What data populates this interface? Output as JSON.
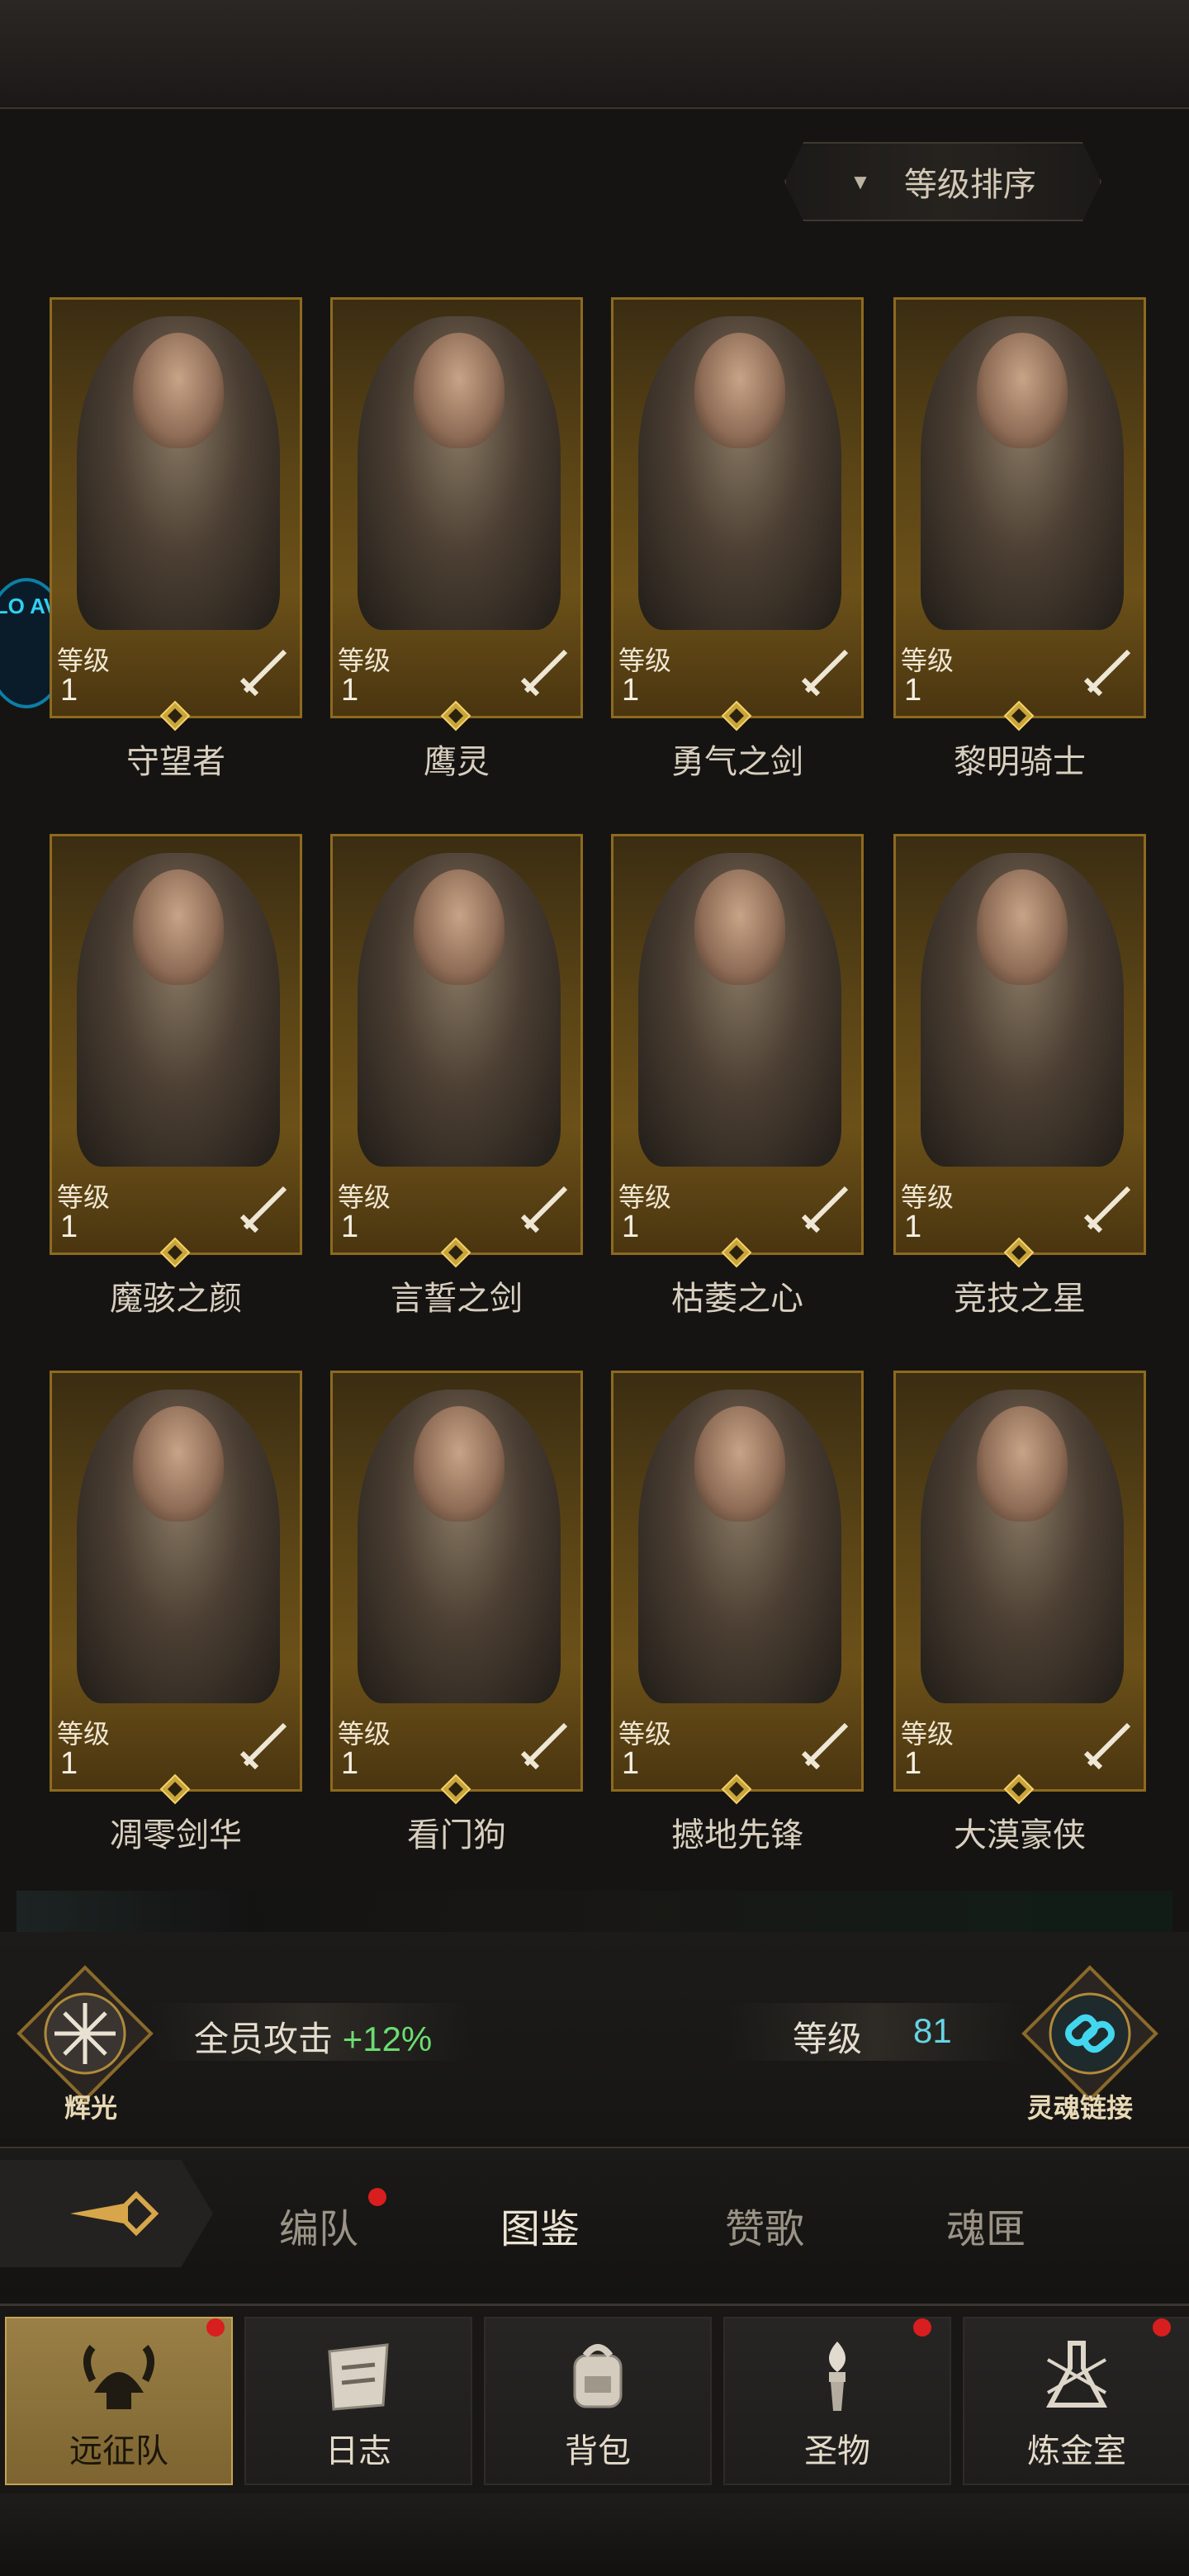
{
  "sort": {
    "label": "等级排序"
  },
  "heroes": [
    {
      "name": "守望者",
      "level_label": "等级",
      "level": "1"
    },
    {
      "name": "鹰灵",
      "level_label": "等级",
      "level": "1"
    },
    {
      "name": "勇气之剑",
      "level_label": "等级",
      "level": "1"
    },
    {
      "name": "黎明骑士",
      "level_label": "等级",
      "level": "1"
    },
    {
      "name": "魔骇之颜",
      "level_label": "等级",
      "level": "1"
    },
    {
      "name": "言誓之剑",
      "level_label": "等级",
      "level": "1"
    },
    {
      "name": "枯萎之心",
      "level_label": "等级",
      "level": "1"
    },
    {
      "name": "竞技之星",
      "level_label": "等级",
      "level": "1"
    },
    {
      "name": "凋零剑华",
      "level_label": "等级",
      "level": "1"
    },
    {
      "name": "看门狗",
      "level_label": "等级",
      "level": "1"
    },
    {
      "name": "撼地先锋",
      "level_label": "等级",
      "level": "1"
    },
    {
      "name": "大漠豪侠",
      "level_label": "等级",
      "level": "1"
    }
  ],
  "bonus": {
    "emblem_label": "辉光",
    "text": "全员攻击",
    "value": "+12%",
    "level_label": "等级",
    "level_value": "81",
    "link_label": "灵魂链接"
  },
  "tabs": [
    {
      "label": "编队",
      "has_dot": true
    },
    {
      "label": "图鉴",
      "active": true
    },
    {
      "label": "赞歌"
    },
    {
      "label": "魂匣"
    }
  ],
  "nav": [
    {
      "label": "远征队",
      "active": true,
      "has_dot": true
    },
    {
      "label": "日志"
    },
    {
      "label": "背包"
    },
    {
      "label": "圣物",
      "has_dot": true
    },
    {
      "label": "炼金室",
      "has_dot": true
    }
  ],
  "side_badge": {
    "label": "LO AV"
  },
  "colors": {
    "accent_gold": "#8d6a1f",
    "bonus_green": "#6cdc72",
    "level_cyan": "#67d4e4",
    "dot_red": "#d81e1e"
  }
}
